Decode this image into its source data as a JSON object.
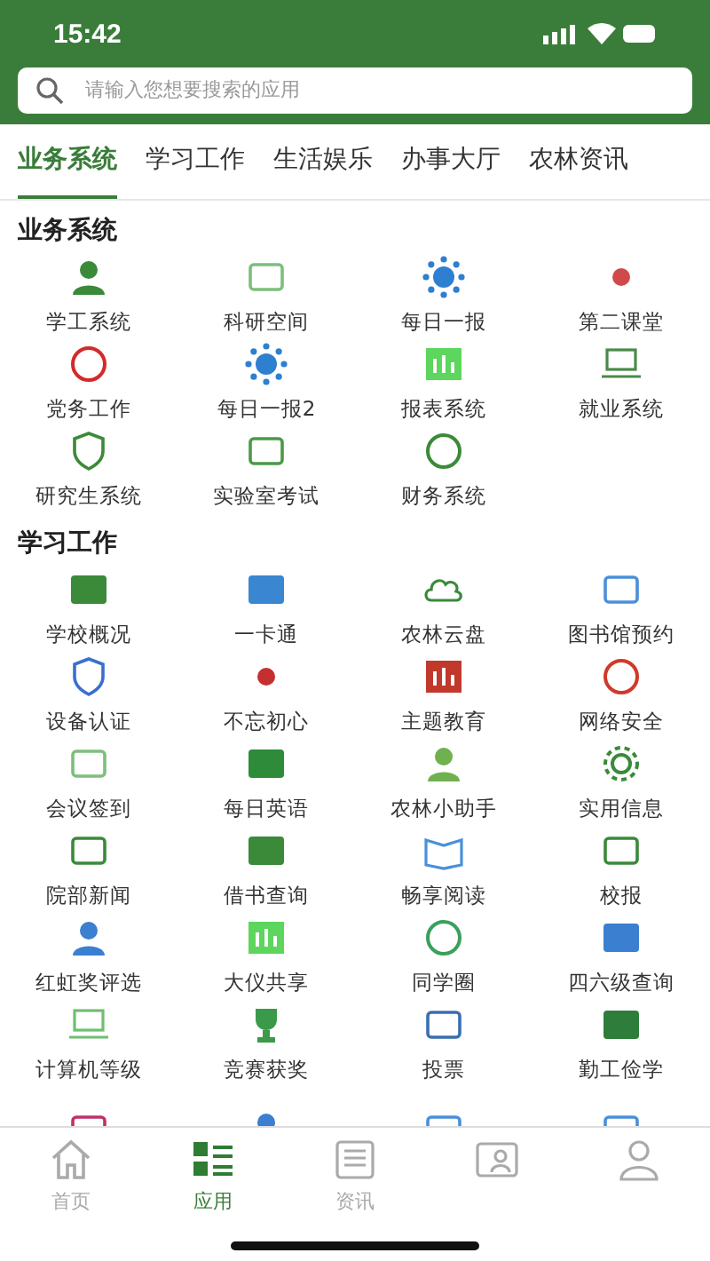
{
  "status_bar": {
    "time": "15:42"
  },
  "search": {
    "placeholder": "请输入您想要搜索的应用"
  },
  "tabs": [
    {
      "label": "业务系统",
      "selected": true
    },
    {
      "label": "学习工作",
      "selected": false
    },
    {
      "label": "生活娱乐",
      "selected": false
    },
    {
      "label": "办事大厅",
      "selected": false
    },
    {
      "label": "农林资讯",
      "selected": false
    }
  ],
  "sections": [
    {
      "title": "业务系统",
      "apps": [
        "学工系统",
        "科研空间",
        "每日一报",
        "第二课堂",
        "党务工作",
        "每日一报2",
        "报表系统",
        "就业系统",
        "研究生系统",
        "实验室考试",
        "财务系统"
      ]
    },
    {
      "title": "学习工作",
      "apps": [
        "学校概况",
        "一卡通",
        "农林云盘",
        "图书馆预约",
        "设备认证",
        "不忘初心",
        "主题教育",
        "网络安全",
        "会议签到",
        "每日英语",
        "农林小助手",
        "实用信息",
        "院部新闻",
        "借书查询",
        "畅享阅读",
        "校报",
        "红虹奖评选",
        "大仪共享",
        "同学圈",
        "四六级查询",
        "计算机等级",
        "竞赛获奖",
        "投票",
        "勤工俭学"
      ]
    }
  ],
  "bottom_nav": [
    {
      "label": "首页",
      "selected": false
    },
    {
      "label": "应用",
      "selected": true
    },
    {
      "label": "资讯",
      "selected": false
    },
    {
      "selected": false
    },
    {
      "selected": false
    }
  ]
}
